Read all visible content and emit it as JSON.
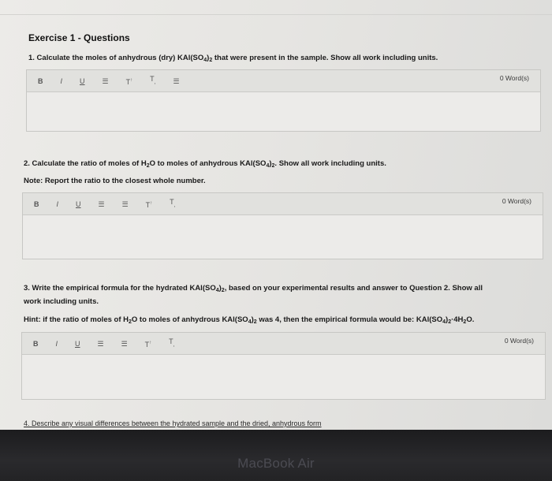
{
  "exercise_title": "Exercise 1 - Questions",
  "questions": [
    {
      "text_a": "1. Calculate the moles of anhydrous (dry) KAl(SO",
      "sub": "4",
      "text_b": ")",
      "sub2": "2",
      "text_c": " that were present in the sample. Show all work including units."
    },
    {
      "text_a": "2. Calculate the ratio of moles of H",
      "sub": "2",
      "text_b": "O to moles of anhydrous KAl(SO",
      "sub2": "4",
      "text_c": ")",
      "sub3": "2",
      "text_d": ". Show all work including units.",
      "note": "Note: Report the ratio to the closest whole number."
    },
    {
      "line1_a": "3. Write the empirical formula for the hydrated KAl(SO",
      "line1_sub": "4",
      "line1_b": ")",
      "line1_sub2": "2",
      "line1_c": ", based on your experimental results and answer to Question 2. Show all",
      "line2": "work including units.",
      "hint_a": "Hint: if the ratio of moles of H",
      "hint_sub": "2",
      "hint_b": "O to moles of anhydrous KAl(SO",
      "hint_sub2": "4",
      "hint_c": ")",
      "hint_sub3": "2",
      "hint_d": " was 4, then the empirical formula would be: KAl(SO",
      "hint_sub4": "4",
      "hint_e": ")",
      "hint_sub5": "2",
      "hint_f": "·4H",
      "hint_sub6": "2",
      "hint_g": "O."
    }
  ],
  "toolbar": {
    "bold": "B",
    "italic": "I",
    "underline": "U",
    "superscript": "T",
    "superscript_mark": "↑",
    "subscript": "T",
    "subscript_mark": ","
  },
  "word_count": "0 Word(s)",
  "q4_partial": "4. Describe any visual differences between the hydrated sample and the dried, anhydrous form",
  "laptop_brand": "MacBook Air"
}
